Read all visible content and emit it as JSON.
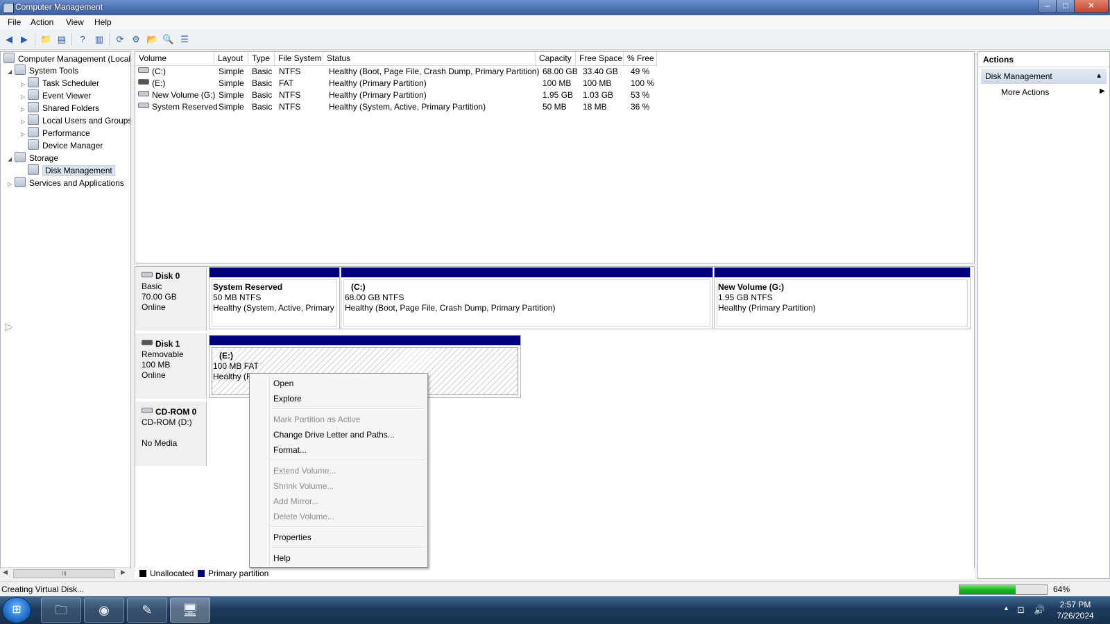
{
  "window": {
    "title": "Computer Management",
    "minimize": "–",
    "maximize": "□",
    "close": "✕"
  },
  "menu": [
    "File",
    "Action",
    "View",
    "Help"
  ],
  "toolbar": {
    "icons": [
      "back-icon",
      "forward-icon",
      "up-folder-icon",
      "show-hide-tree-icon",
      "help-icon",
      "show-hide-action-pane-icon",
      "refresh-icon",
      "properties-icon",
      "open-icon",
      "rescan-icon",
      "settings-icon"
    ],
    "glyphs": {
      "back": "◀",
      "forward": "▶",
      "up": "📁",
      "tree": "▤",
      "help": "?",
      "pane": "▥",
      "refresh": "⟳",
      "properties": "⚙",
      "open": "📂",
      "rescan": "🔍",
      "settings": "☰"
    }
  },
  "tree": {
    "root": "Computer Management (Local",
    "system_tools": "System Tools",
    "task_scheduler": "Task Scheduler",
    "event_viewer": "Event Viewer",
    "shared_folders": "Shared Folders",
    "local_users": "Local Users and Groups",
    "performance": "Performance",
    "device_manager": "Device Manager",
    "storage": "Storage",
    "disk_management": "Disk Management",
    "services": "Services and Applications",
    "hscroll_grip": "III"
  },
  "volume_list": {
    "headers": {
      "volume": "Volume",
      "layout": "Layout",
      "type": "Type",
      "fs": "File System",
      "status": "Status",
      "capacity": "Capacity",
      "free": "Free Space",
      "pct": "% Free"
    },
    "rows": [
      {
        "volume": "(C:)",
        "layout": "Simple",
        "type": "Basic",
        "fs": "NTFS",
        "status": "Healthy (Boot, Page File, Crash Dump, Primary Partition)",
        "capacity": "68.00 GB",
        "free": "33.40 GB",
        "pct": "49 %"
      },
      {
        "volume": "(E:)",
        "layout": "Simple",
        "type": "Basic",
        "fs": "FAT",
        "status": "Healthy (Primary Partition)",
        "capacity": "100 MB",
        "free": "100 MB",
        "pct": "100 %"
      },
      {
        "volume": "New Volume (G:)",
        "layout": "Simple",
        "type": "Basic",
        "fs": "NTFS",
        "status": "Healthy (Primary Partition)",
        "capacity": "1.95 GB",
        "free": "1.03 GB",
        "pct": "53 %"
      },
      {
        "volume": "System Reserved",
        "layout": "Simple",
        "type": "Basic",
        "fs": "NTFS",
        "status": "Healthy (System, Active, Primary Partition)",
        "capacity": "50 MB",
        "free": "18 MB",
        "pct": "36 %"
      }
    ]
  },
  "disks": {
    "disk0": {
      "name": "Disk 0",
      "type": "Basic",
      "size": "70.00 GB",
      "state": "Online",
      "partitions": {
        "sysres": {
          "title": "System Reserved",
          "size": "50 MB NTFS",
          "status": "Healthy (System, Active, Primary"
        },
        "c": {
          "title": "(C:)",
          "size": "68.00 GB NTFS",
          "status": "Healthy (Boot, Page File, Crash Dump, Primary Partition)"
        },
        "g": {
          "title": "New Volume  (G:)",
          "size": "1.95 GB NTFS",
          "status": "Healthy (Primary Partition)"
        }
      }
    },
    "disk1": {
      "name": "Disk 1",
      "type": "Removable",
      "size": "100 MB",
      "state": "Online",
      "partition": {
        "title": "(E:)",
        "size": "100 MB FAT",
        "status": "Healthy (P"
      }
    },
    "cdrom0": {
      "name": "CD-ROM 0",
      "type": "CD-ROM (D:)",
      "state": "No Media"
    }
  },
  "legend": {
    "unallocated": "Unallocated",
    "primary": "Primary partition",
    "unallocated_color": "#000000",
    "primary_color": "#00007f"
  },
  "context_menu": {
    "open": "Open",
    "explore": "Explore",
    "mark_active": "Mark Partition as Active",
    "change_letter": "Change Drive Letter and Paths...",
    "format": "Format...",
    "extend": "Extend Volume...",
    "shrink": "Shrink Volume...",
    "add_mirror": "Add Mirror...",
    "delete": "Delete Volume...",
    "properties": "Properties",
    "help": "Help"
  },
  "actions": {
    "header": "Actions",
    "group": "Disk Management",
    "more": "More Actions"
  },
  "status": {
    "text": "Creating Virtual Disk...",
    "progress_label": "64%",
    "progress": 0.64
  },
  "taskbar": {
    "time": "2:57 PM",
    "date": "7/26/2024"
  }
}
